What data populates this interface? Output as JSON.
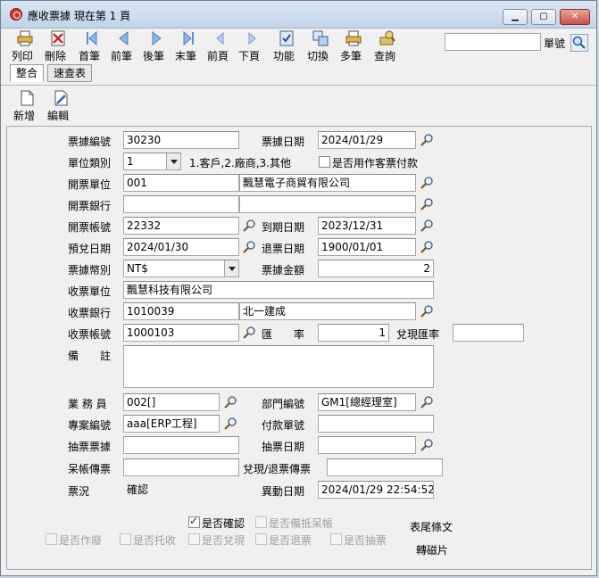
{
  "window": {
    "title": "應收票據 現在第 1 頁"
  },
  "toolbar": [
    {
      "id": "print",
      "label": "列印"
    },
    {
      "id": "delete",
      "label": "刪除"
    },
    {
      "id": "first",
      "label": "首筆"
    },
    {
      "id": "prev",
      "label": "前筆"
    },
    {
      "id": "next",
      "label": "後筆"
    },
    {
      "id": "last",
      "label": "末筆"
    },
    {
      "id": "prevpage",
      "label": "前頁"
    },
    {
      "id": "nextpage",
      "label": "下頁"
    },
    {
      "id": "function",
      "label": "功能"
    },
    {
      "id": "switch",
      "label": "切換"
    },
    {
      "id": "multi",
      "label": "多筆"
    },
    {
      "id": "query",
      "label": "查詢"
    }
  ],
  "search": {
    "label": "單號",
    "value": ""
  },
  "tabs": [
    {
      "label": "整合"
    },
    {
      "label": "速查表"
    }
  ],
  "subtoolbar": [
    {
      "label": "新增"
    },
    {
      "label": "編輯"
    }
  ],
  "form": {
    "note_no": {
      "label": "票據編號",
      "value": "30230"
    },
    "note_date": {
      "label": "票據日期",
      "value": "2024/01/29"
    },
    "unit_type": {
      "label": "單位類別",
      "value": "1",
      "hint": "1.客戶,2.廠商,3.其他"
    },
    "use_customer_check": {
      "label": "是否用作客票付款"
    },
    "issuer_unit": {
      "label": "開票單位",
      "code": "001",
      "name": "飄慧電子商貿有限公司"
    },
    "issuer_bank": {
      "label": "開票銀行",
      "code": "",
      "name": ""
    },
    "issuer_account": {
      "label": "開票帳號",
      "value": "22332"
    },
    "due_date": {
      "label": "到期日期",
      "value": "2023/12/31"
    },
    "expected_date": {
      "label": "預兌日期",
      "value": "2024/01/30"
    },
    "return_date": {
      "label": "退票日期",
      "value": "1900/01/01"
    },
    "currency": {
      "label": "票據幣別",
      "value": "NT$"
    },
    "amount": {
      "label": "票據金額",
      "value": "2"
    },
    "receiver_unit": {
      "label": "收票單位",
      "value": "飄慧科技有限公司"
    },
    "receiver_bank": {
      "label": "收票銀行",
      "code": "1010039",
      "name": "北一建成"
    },
    "receiver_account": {
      "label": "收票帳號",
      "value": "1000103"
    },
    "rate": {
      "label": "匯　　率",
      "value": "1"
    },
    "cash_rate": {
      "label": "兌現匯率",
      "value": ""
    },
    "remark": {
      "label": "備　　註",
      "value": ""
    },
    "salesman": {
      "label": "業 務 員",
      "value": "002[]"
    },
    "dept_no": {
      "label": "部門編號",
      "value": "GM1[總經理室]"
    },
    "project_no": {
      "label": "專案編號",
      "value": "aaa[ERP工程]"
    },
    "payment_no": {
      "label": "付款單號",
      "value": ""
    },
    "drawn_note": {
      "label": "抽票票據",
      "value": ""
    },
    "drawn_date": {
      "label": "抽票日期",
      "value": ""
    },
    "bad_debt_voucher": {
      "label": "呆帳傳票",
      "value": ""
    },
    "cash_return_voucher": {
      "label": "兌現/退票傳票",
      "value": ""
    },
    "status": {
      "label": "票況",
      "value": "確認"
    },
    "change_date": {
      "label": "異動日期",
      "value": "2024/01/29 22:54:52"
    }
  },
  "checks": {
    "confirmed": {
      "label": "是否確認",
      "checked": true
    },
    "offset_bad": {
      "label": "是否備抵呆帳",
      "checked": false
    },
    "void": {
      "label": "是否作廢",
      "checked": false
    },
    "consign": {
      "label": "是否托收",
      "checked": false
    },
    "cashed": {
      "label": "是否兌現",
      "checked": false
    },
    "returned": {
      "label": "是否退票",
      "checked": false
    },
    "drawn": {
      "label": "是否抽票",
      "checked": false
    }
  },
  "side_labels": {
    "footer_text": "表尾條文",
    "transfer": "轉磁片"
  }
}
